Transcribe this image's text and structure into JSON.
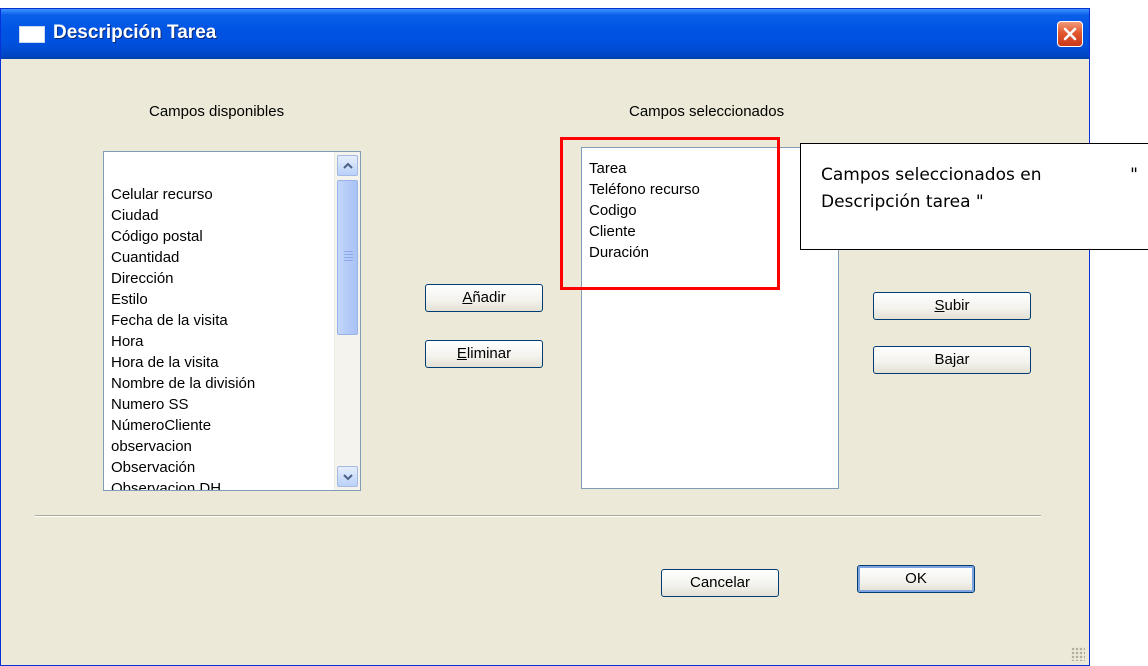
{
  "window": {
    "title": "Descripción Tarea"
  },
  "available": {
    "label": "Campos disponibles",
    "items": [
      "Celular recurso",
      "Ciudad",
      "Código postal",
      "Cuantidad",
      "Dirección",
      "Estilo",
      "Fecha de la visita",
      "Hora",
      "Hora de la visita",
      "Nombre de la división",
      "Numero SS",
      "NúmeroCliente",
      "observacion",
      "Observación",
      "Observacion DH"
    ]
  },
  "selected": {
    "label": "Campos seleccionados",
    "items": [
      "Tarea",
      "Teléfono recurso",
      "Codigo",
      "Cliente",
      "Duración"
    ]
  },
  "buttons": {
    "add_prefix": "",
    "add_accel": "A",
    "add_rest": "ñadir",
    "remove_accel": "E",
    "remove_rest": "liminar",
    "up_accel": "S",
    "up_rest": "ubir",
    "down": "Bajar",
    "cancel": "Cancelar",
    "ok": "OK"
  },
  "callout": {
    "line1_left": "Campos seleccionados en",
    "line1_right": "\"",
    "line2": "Descripción tarea \""
  },
  "icons": {
    "close": "close-x-icon",
    "window": "window-icon",
    "scroll_up": "chevron-up-icon",
    "scroll_down": "chevron-down-icon"
  }
}
